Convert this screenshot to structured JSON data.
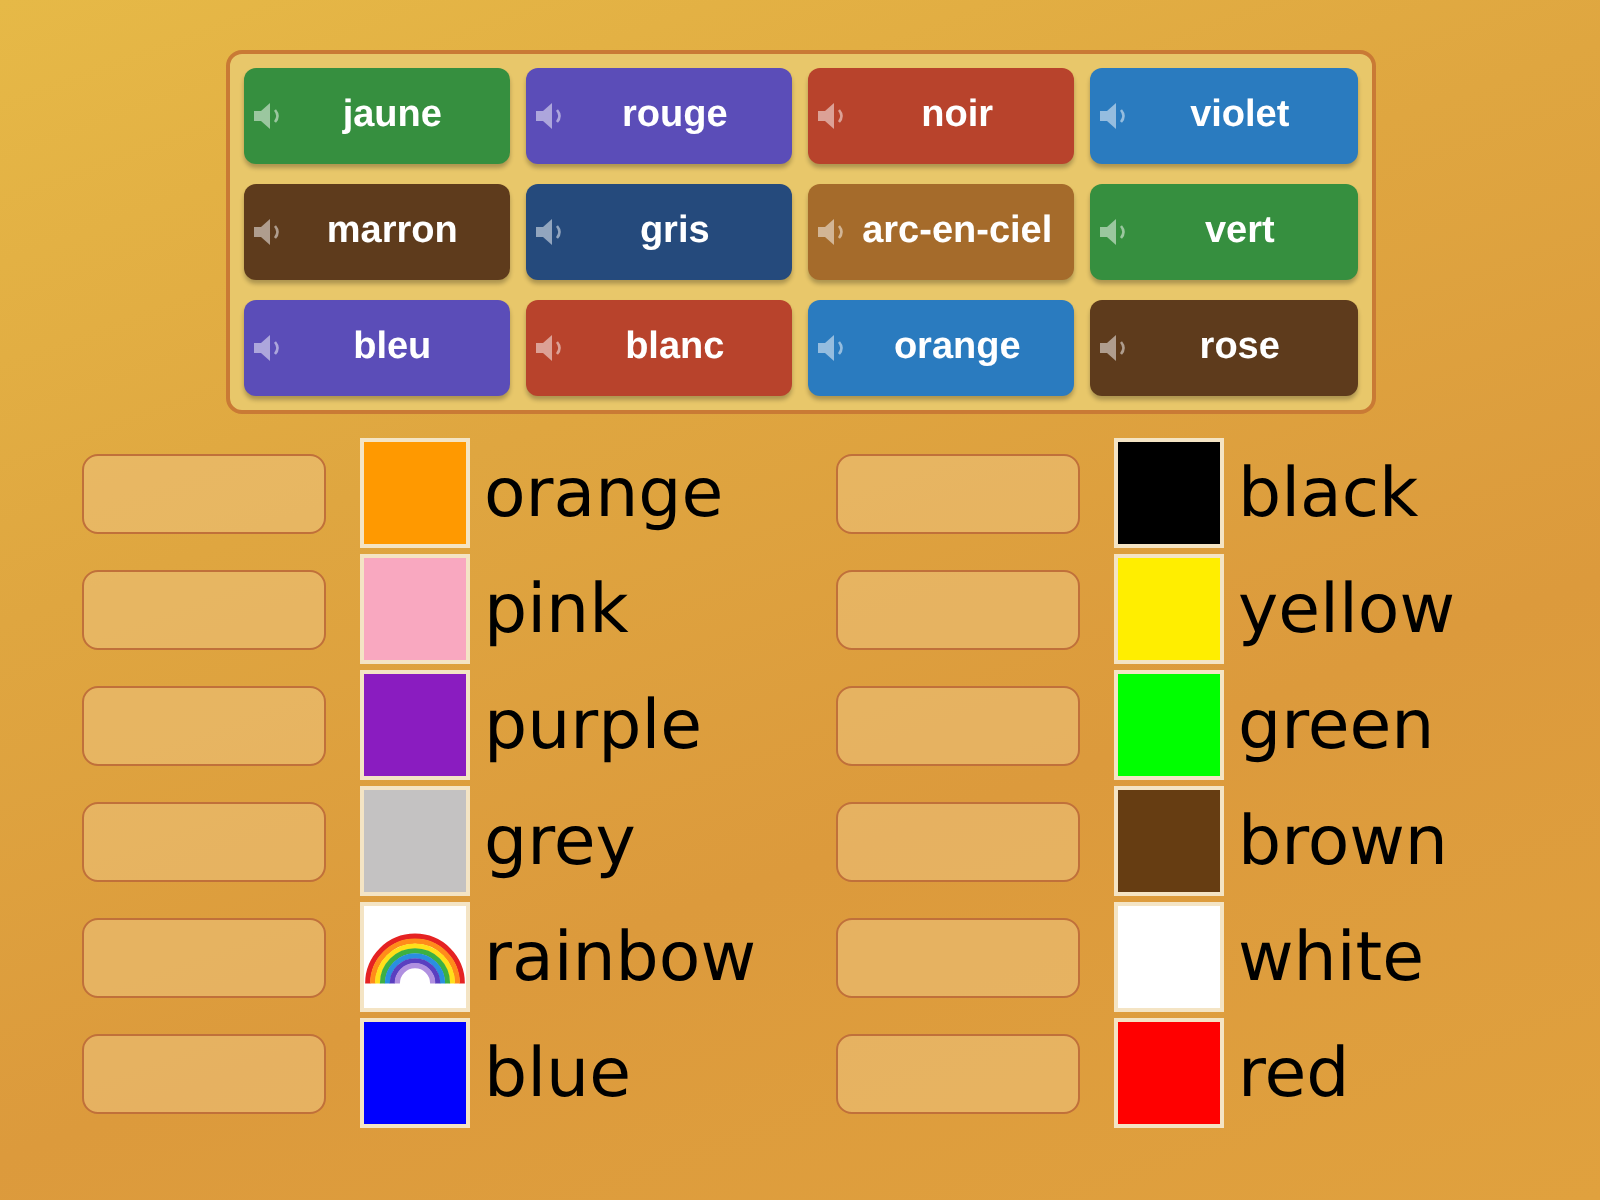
{
  "word_bank": {
    "tiles": [
      {
        "text": "jaune",
        "color": "#368f3f"
      },
      {
        "text": "rouge",
        "color": "#5b4db8"
      },
      {
        "text": "noir",
        "color": "#b8432c"
      },
      {
        "text": "violet",
        "color": "#2a7bbf"
      },
      {
        "text": "marron",
        "color": "#5e3b1c"
      },
      {
        "text": "gris",
        "color": "#254a7c"
      },
      {
        "text": "arc-en-ciel",
        "color": "#a56b2b"
      },
      {
        "text": "vert",
        "color": "#368f3f"
      },
      {
        "text": "bleu",
        "color": "#5b4db8"
      },
      {
        "text": "blanc",
        "color": "#b8432c"
      },
      {
        "text": "orange",
        "color": "#2a7bbf"
      },
      {
        "text": "rose",
        "color": "#5e3b1c"
      }
    ]
  },
  "columns": [
    {
      "rows": [
        {
          "kind": "swatch",
          "color": "#ff9900",
          "label": "orange"
        },
        {
          "kind": "swatch",
          "color": "#f9a8c0",
          "label": "pink"
        },
        {
          "kind": "swatch",
          "color": "#8a1cc0",
          "label": "purple"
        },
        {
          "kind": "swatch",
          "color": "#c4c2c2",
          "label": "grey"
        },
        {
          "kind": "rainbow",
          "label": "rainbow"
        },
        {
          "kind": "swatch",
          "color": "#0000ff",
          "label": "blue"
        }
      ]
    },
    {
      "rows": [
        {
          "kind": "swatch",
          "color": "#000000",
          "label": "black"
        },
        {
          "kind": "swatch",
          "color": "#ffee00",
          "label": "yellow"
        },
        {
          "kind": "swatch",
          "color": "#00ff00",
          "label": "green"
        },
        {
          "kind": "swatch",
          "color": "#663d12",
          "label": "brown"
        },
        {
          "kind": "swatch",
          "color": "#ffffff",
          "label": "white"
        },
        {
          "kind": "swatch",
          "color": "#ff0000",
          "label": "red"
        }
      ]
    }
  ]
}
